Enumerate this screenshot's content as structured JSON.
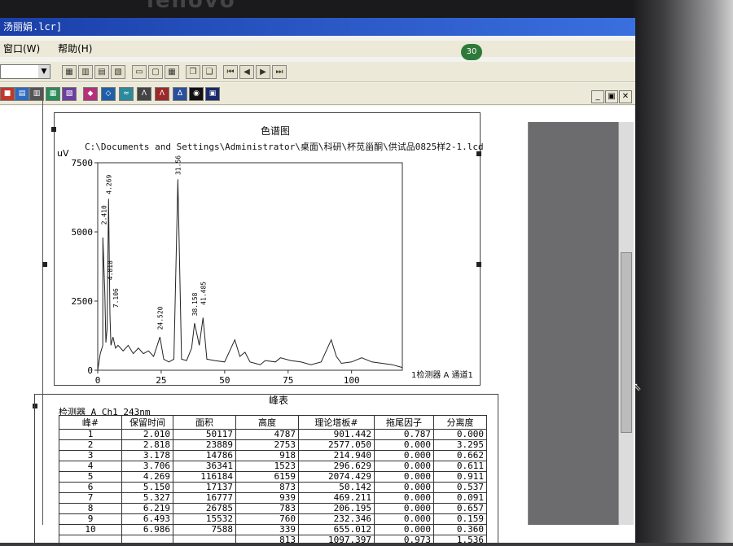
{
  "monitor": {
    "brand": "lenovo"
  },
  "window": {
    "title": "汤丽娟.lcr]",
    "notification_badge": "30",
    "menu": [
      "窗口(W)",
      "帮助(H)"
    ],
    "buttons": {
      "minimize": "_",
      "restore": "▣",
      "close": "✕"
    }
  },
  "chart": {
    "title": "色谱图",
    "path": "C:\\Documents and Settings\\Administrator\\桌面\\科研\\杯苋甾酮\\供试品0825样2-1.lcd",
    "unit": "uV",
    "y_ticks": [
      "7500",
      "5000",
      "2500",
      "0"
    ],
    "x_ticks": [
      "0",
      "25",
      "50",
      "75",
      "100"
    ],
    "channel_label": "1检测器 A 通道1",
    "peak_labels": [
      "2.410",
      "4.269",
      "4.818",
      "7.106",
      "24.520",
      "31.561",
      "38.158",
      "41.485"
    ]
  },
  "chart_data": {
    "type": "line",
    "title": "色谱图",
    "ylabel": "uV",
    "xlim": [
      0,
      120
    ],
    "ylim": [
      0,
      7500
    ],
    "x": [
      0,
      1,
      2,
      2.01,
      2.8,
      3.2,
      3.7,
      4.27,
      4.8,
      5.2,
      6,
      7,
      8,
      10,
      12,
      14,
      16,
      18,
      20,
      22,
      24.5,
      26,
      28,
      30,
      31.56,
      33,
      35,
      37,
      38.16,
      40,
      41.49,
      43,
      46,
      50,
      54,
      56,
      58,
      60,
      62,
      64,
      66,
      70,
      72,
      76,
      80,
      84,
      88,
      90,
      92,
      94,
      96,
      100,
      104,
      108,
      112,
      116,
      120
    ],
    "y": [
      0,
      600,
      900,
      4800,
      2800,
      1000,
      1500,
      6200,
      2000,
      900,
      1200,
      800,
      900,
      700,
      900,
      600,
      800,
      600,
      700,
      500,
      1200,
      400,
      300,
      400,
      6900,
      400,
      350,
      800,
      1700,
      900,
      1900,
      400,
      350,
      300,
      1100,
      500,
      650,
      300,
      250,
      200,
      350,
      300,
      450,
      350,
      300,
      200,
      300,
      700,
      1100,
      500,
      250,
      300,
      450,
      300,
      250,
      200,
      100
    ]
  },
  "peak_table": {
    "title": "峰表",
    "detector_label": "检测器 A Ch1 243nm",
    "headers": [
      "峰#",
      "保留时间",
      "面积",
      "高度",
      "理论塔板#",
      "拖尾因子",
      "分离度"
    ],
    "rows": [
      [
        "1",
        "2.010",
        "50117",
        "4787",
        "901.442",
        "0.787",
        "0.000"
      ],
      [
        "2",
        "2.818",
        "23889",
        "2753",
        "2577.050",
        "0.000",
        "3.295"
      ],
      [
        "3",
        "3.178",
        "14786",
        "918",
        "214.940",
        "0.000",
        "0.662"
      ],
      [
        "4",
        "3.706",
        "36341",
        "1523",
        "296.629",
        "0.000",
        "0.611"
      ],
      [
        "5",
        "4.269",
        "116184",
        "6159",
        "2074.429",
        "0.000",
        "0.911"
      ],
      [
        "6",
        "5.150",
        "17137",
        "873",
        "50.142",
        "0.000",
        "0.537"
      ],
      [
        "7",
        "5.327",
        "16777",
        "939",
        "469.211",
        "0.000",
        "0.091"
      ],
      [
        "8",
        "6.219",
        "26785",
        "783",
        "206.195",
        "0.000",
        "0.657"
      ],
      [
        "9",
        "6.493",
        "15532",
        "760",
        "232.346",
        "0.000",
        "0.159"
      ],
      [
        "10",
        "6.986",
        "7588",
        "339",
        "655.012",
        "0.000",
        "0.360"
      ],
      [
        "",
        "",
        "",
        "813",
        "1097.397",
        "0.973",
        "1.536"
      ]
    ]
  }
}
